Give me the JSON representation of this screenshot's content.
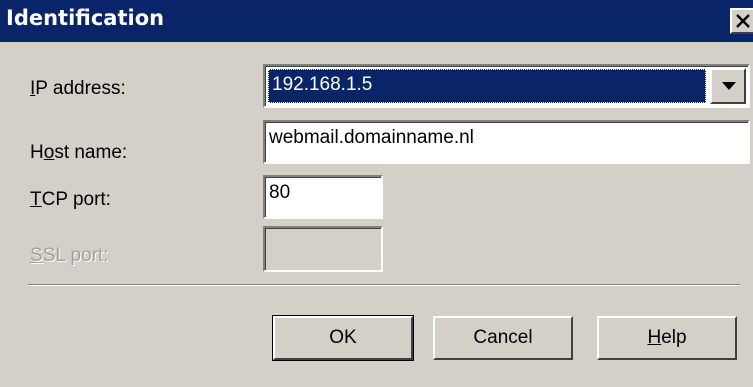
{
  "window": {
    "title": "Identification",
    "close_icon": "close-icon"
  },
  "fields": {
    "ip_address": {
      "label_accel": "I",
      "label_rest": "P address:",
      "value": "192.168.1.5",
      "arrow_icon": "chevron-down-icon"
    },
    "host_name": {
      "label_pre": "H",
      "label_accel": "o",
      "label_rest": "st name:",
      "value": "webmail.domainname.nl"
    },
    "tcp_port": {
      "label_accel": "T",
      "label_rest": "CP port:",
      "value": "80"
    },
    "ssl_port": {
      "label_accel": "S",
      "label_rest": "SL port:",
      "value": "",
      "disabled": true
    }
  },
  "buttons": {
    "ok": "OK",
    "cancel": "Cancel",
    "help_accel": "H",
    "help_rest": "elp"
  },
  "colors": {
    "titlebar": "#0a246a",
    "face": "#d4d0c8",
    "selection": "#0a246a"
  }
}
